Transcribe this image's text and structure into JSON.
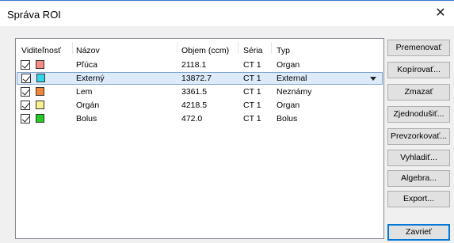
{
  "window": {
    "title": "Správa ROI",
    "close_glyph": "✕"
  },
  "list": {
    "columns": {
      "visibility": "Viditeľnosť",
      "name": "Názov",
      "volume": "Objem (ccm)",
      "series": "Séria",
      "type": "Typ"
    },
    "rows": [
      {
        "name": "Pľúca",
        "volume": "2118.1",
        "series": "CT 1",
        "type": "Organ",
        "color": "#f48c84",
        "visible": true
      },
      {
        "name": "Externý",
        "volume": "13872.7",
        "series": "CT 1",
        "type": "External",
        "color": "#33d6e8",
        "visible": true
      },
      {
        "name": "Lem",
        "volume": "3361.5",
        "series": "CT 1",
        "type": "Neznámy",
        "color": "#f3853b",
        "visible": true
      },
      {
        "name": "Orgán",
        "volume": "4218.5",
        "series": "CT 1",
        "type": "Organ",
        "color": "#fbf28e",
        "visible": true
      },
      {
        "name": "Bolus",
        "volume": "472.0",
        "series": "CT 1",
        "type": "Bolus",
        "color": "#22cc22",
        "visible": true
      }
    ],
    "selected_row": 1
  },
  "buttons": {
    "rename": "Premenovať",
    "copy": "Kopírovať...",
    "delete": "Zmazať",
    "simplify": "Zjednodušiť...",
    "resample": "Prevzorkovať...",
    "smooth": "Vyhladiť...",
    "algebra": "Algebra...",
    "export": "Export...",
    "close": "Zavrieť"
  }
}
